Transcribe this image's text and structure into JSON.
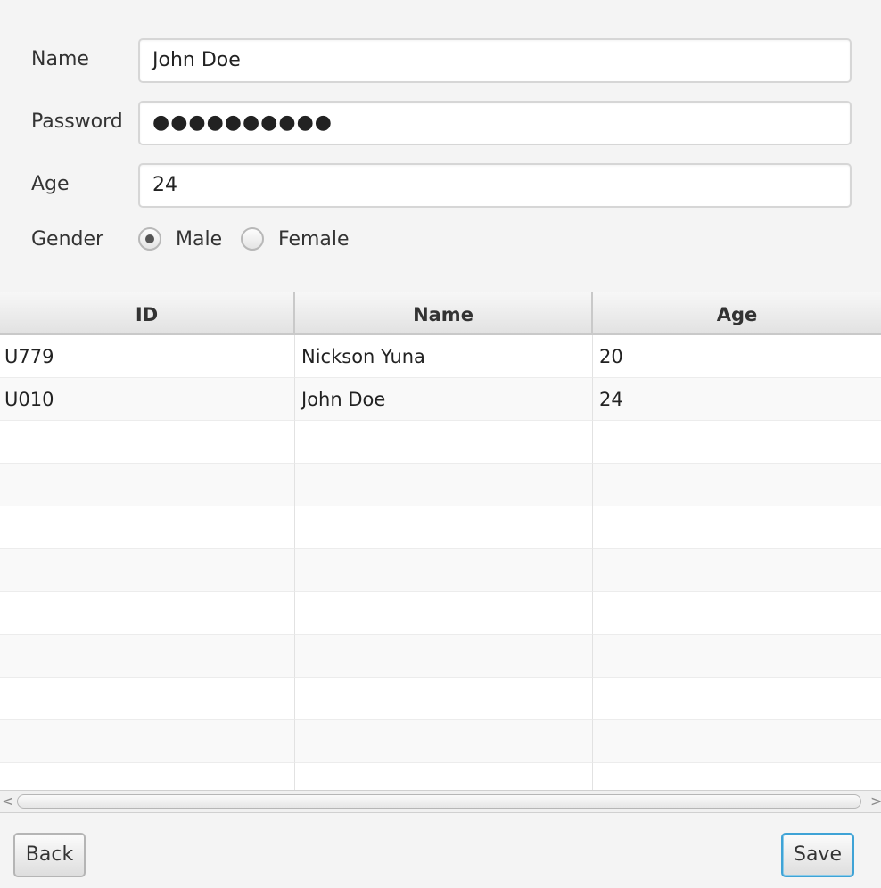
{
  "form": {
    "name_label": "Name",
    "name_value": "John Doe",
    "password_label": "Password",
    "password_value": "●●●●●●●●●●",
    "age_label": "Age",
    "age_value": "24",
    "gender_label": "Gender",
    "gender_options": [
      {
        "label": "Male",
        "selected": true
      },
      {
        "label": "Female",
        "selected": false
      }
    ]
  },
  "table": {
    "columns": [
      "ID",
      "Name",
      "Age"
    ],
    "rows": [
      [
        "U779",
        "Nickson Yuna",
        "20"
      ],
      [
        "U010",
        "John Doe",
        "24"
      ]
    ]
  },
  "scrollbar": {
    "left_arrow": "<",
    "right_arrow": ">"
  },
  "buttons": {
    "back_label": "Back",
    "save_label": "Save"
  }
}
